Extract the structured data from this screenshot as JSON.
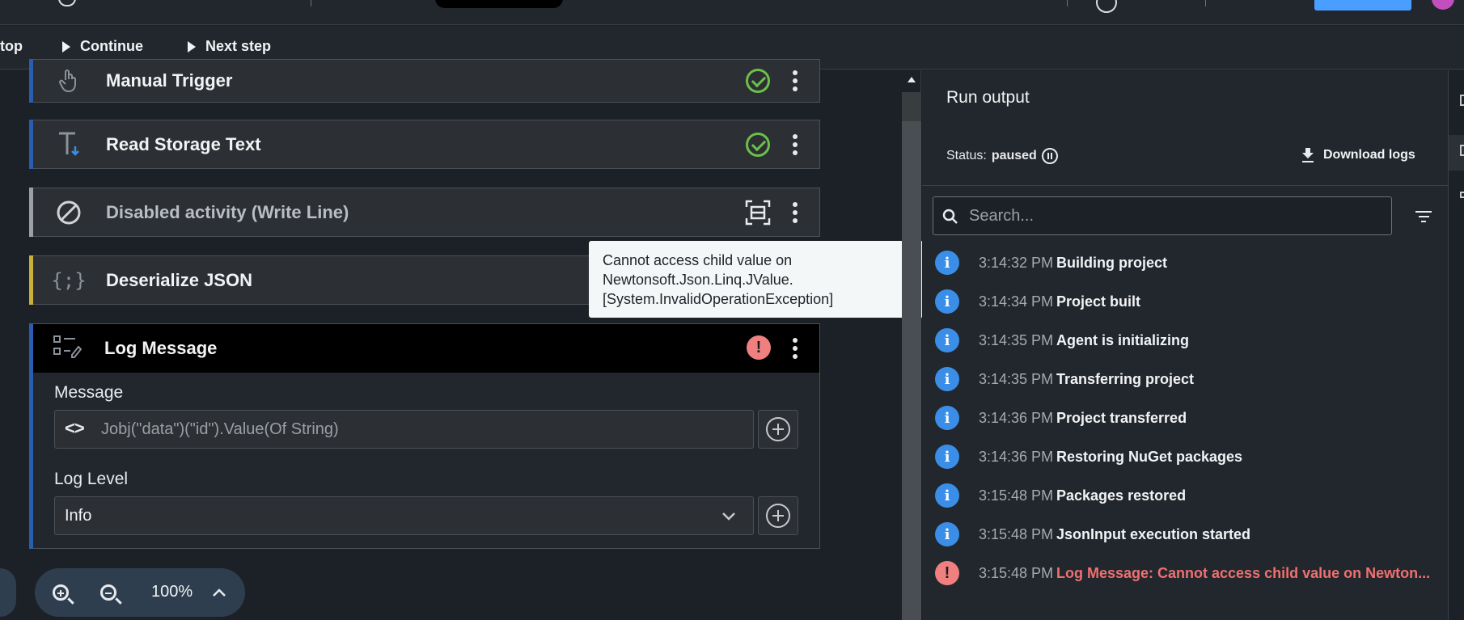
{
  "toolbar": {
    "stop_label": "top",
    "continue_label": "Continue",
    "next_step_label": "Next step"
  },
  "activities": [
    {
      "title": "Manual Trigger",
      "icon": "hand-pointer-icon",
      "state": "success",
      "accent": "#2a5db0"
    },
    {
      "title": "Read Storage Text",
      "icon": "text-download-icon",
      "state": "success",
      "accent": "#2a5db0"
    },
    {
      "title": "Disabled activity (Write Line)",
      "icon": "disabled-icon",
      "state": "disabled",
      "accent": "#9aa0a6"
    },
    {
      "title": "Deserialize JSON",
      "icon": "json-braces-icon",
      "state": "normal",
      "accent": "#c9b037"
    },
    {
      "title": "Log Message",
      "icon": "log-list-icon",
      "state": "error",
      "accent": "#2a5db0"
    }
  ],
  "log_message": {
    "message_label": "Message",
    "message_value": "Jobj(\"data\")(\"id\").Value(Of String)",
    "log_level_label": "Log Level",
    "log_level_value": "Info"
  },
  "tooltip": {
    "line1": "Cannot access child value on",
    "line2": "Newtonsoft.Json.Linq.JValue.",
    "line3": "[System.InvalidOperationException]"
  },
  "zoom": {
    "value": "100%"
  },
  "run_output": {
    "title": "Run output",
    "status_label": "Status:",
    "status_value": "paused",
    "download_label": "Download logs",
    "search_placeholder": "Search...",
    "logs": [
      {
        "time": "3:14:32 PM",
        "message": "Building project",
        "level": "info"
      },
      {
        "time": "3:14:34 PM",
        "message": "Project built",
        "level": "info"
      },
      {
        "time": "3:14:35 PM",
        "message": "Agent is initializing",
        "level": "info"
      },
      {
        "time": "3:14:35 PM",
        "message": "Transferring project",
        "level": "info"
      },
      {
        "time": "3:14:36 PM",
        "message": "Project transferred",
        "level": "info"
      },
      {
        "time": "3:14:36 PM",
        "message": "Restoring NuGet packages",
        "level": "info"
      },
      {
        "time": "3:15:48 PM",
        "message": "Packages restored",
        "level": "info"
      },
      {
        "time": "3:15:48 PM",
        "message": "JsonInput execution started",
        "level": "info"
      },
      {
        "time": "3:15:48 PM",
        "message": "Log Message: Cannot access child value on Newton...",
        "level": "error"
      }
    ]
  },
  "colors": {
    "info": "#3b8ee8",
    "error": "#f08080",
    "success": "#6cc04a",
    "accent_blue": "#4a9eff"
  }
}
